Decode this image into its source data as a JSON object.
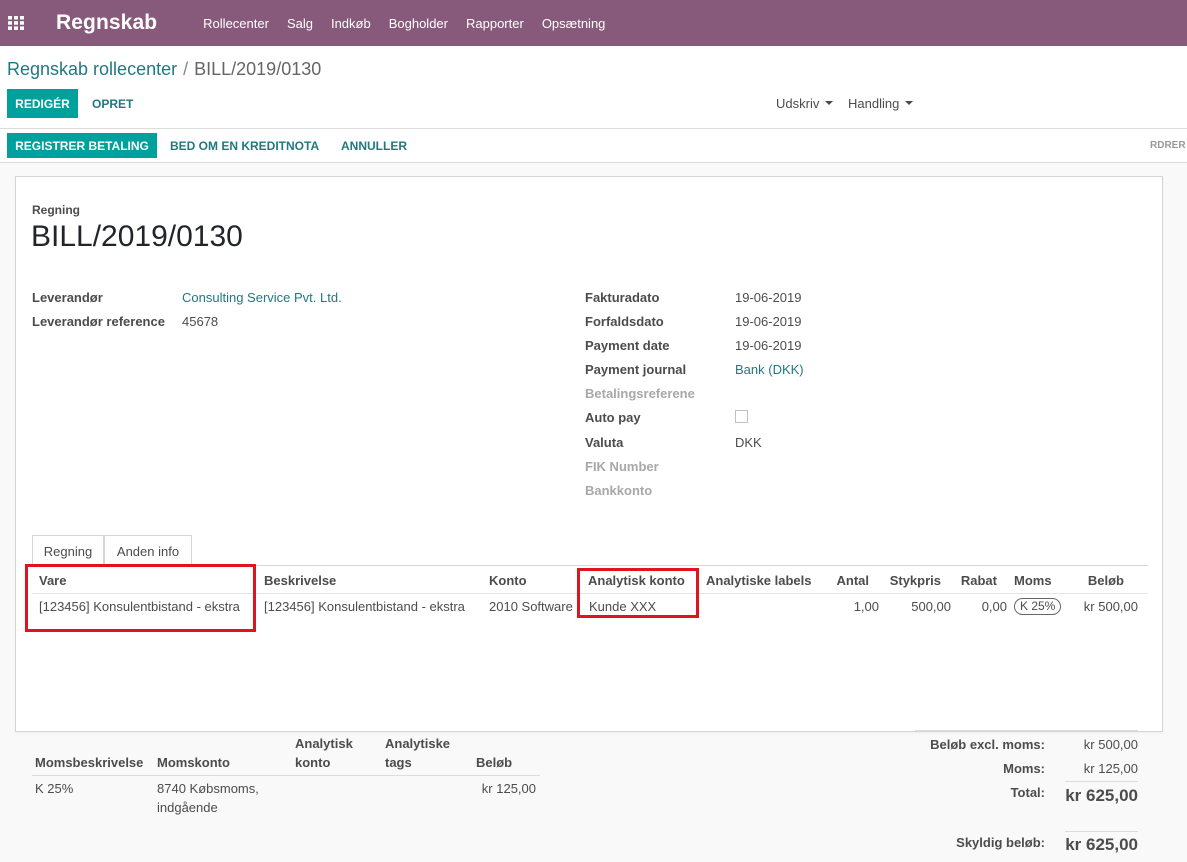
{
  "navbar": {
    "apps_icon": "grid-icon",
    "brand": "Regnskab",
    "menu": [
      "Rollecenter",
      "Salg",
      "Indkøb",
      "Bogholder",
      "Rapporter",
      "Opsætning"
    ]
  },
  "breadcrumb": {
    "parent": "Regnskab rollecenter",
    "separator": "/",
    "current": "BILL/2019/0130"
  },
  "toolbar": {
    "edit": "REDIGÉR",
    "create": "OPRET",
    "print": "Udskriv",
    "action": "Handling"
  },
  "statusbar": {
    "register_payment": "REGISTRER BETALING",
    "credit_note": "BED OM EN KREDITNOTA",
    "cancel": "ANNULLER",
    "orders_cut": "RDRER"
  },
  "document": {
    "type_label": "Regning",
    "name": "BILL/2019/0130"
  },
  "left_fields": [
    {
      "label": "Leverandør",
      "value": "Consulting Service Pvt. Ltd."
    },
    {
      "label": "Leverandør reference",
      "value": "45678"
    }
  ],
  "right_fields": [
    {
      "label": "Fakturadato",
      "value": "19-06-2019"
    },
    {
      "label": "Forfaldsdato",
      "value": "19-06-2019"
    },
    {
      "label": "Payment date",
      "value": "19-06-2019"
    },
    {
      "label": "Payment journal",
      "value": "Bank (DKK)"
    },
    {
      "label": "Betalingsreferene",
      "value": ""
    },
    {
      "label": "Auto pay",
      "value": ""
    },
    {
      "label": "Valuta",
      "value": "DKK"
    },
    {
      "label": "FIK Number",
      "value": ""
    },
    {
      "label": "Bankkonto",
      "value": ""
    }
  ],
  "tabs": [
    "Regning",
    "Anden info"
  ],
  "lines": {
    "headers": [
      "Vare",
      "Beskrivelse",
      "Konto",
      "Analytisk konto",
      "Analytiske labels",
      "Antal",
      "Stykpris",
      "Rabat",
      "Moms",
      "Beløb"
    ],
    "rows": [
      {
        "product": "[123456] Konsulentbistand - ekstra",
        "description": "[123456] Konsulentbistand - ekstra",
        "account": "2010 Software",
        "analytic": "Kunde XXX",
        "labels": "",
        "qty": "1,00",
        "price": "500,00",
        "discount": "0,00",
        "tax": "K 25%",
        "amount": "kr 500,00"
      }
    ]
  },
  "tax_table": {
    "headers": [
      "Momsbeskrivelse",
      "Momskonto",
      "Analytisk konto",
      "Analytiske tags",
      "Beløb"
    ],
    "headers_split": {
      "analytic_1": "Analytisk",
      "analytic_2": "konto",
      "tags_1": "Analytiske",
      "tags_2": "tags"
    },
    "rows": [
      {
        "desc": "K 25%",
        "account_1": "8740 Købsmoms,",
        "account_2": "indgående",
        "amount": "kr 125,00"
      }
    ]
  },
  "totals": {
    "untaxed_label": "Beløb excl. moms:",
    "untaxed": "kr 500,00",
    "tax_label": "Moms:",
    "tax": "kr 125,00",
    "total_label": "Total:",
    "total": "kr 625,00",
    "due_label": "Skyldig beløb:",
    "due": "kr 625,00"
  },
  "colors": {
    "navbar": "#875a7b",
    "primary": "#00a09d",
    "link": "#21787f",
    "highlight": "#e0141e"
  }
}
